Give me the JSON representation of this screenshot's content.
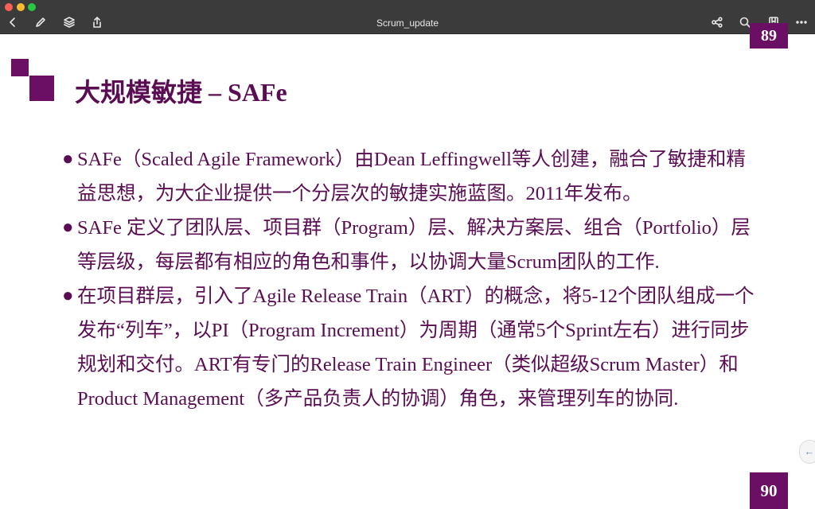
{
  "window": {
    "title": "Scrum_update",
    "traffic_colors": {
      "close": "#ff5f57",
      "minimize": "#febc2e",
      "zoom": "#28c840"
    },
    "toolbar_icons": [
      "back-icon",
      "pencil-icon",
      "layers-icon",
      "share-icon",
      "graph-icon",
      "search-icon",
      "bookmark-icon",
      "more-icon"
    ]
  },
  "slide": {
    "prev_page_number": "89",
    "page_number": "90",
    "title_cn": "大规模敏捷",
    "title_dash": "–",
    "title_en": "SAFe",
    "bullet_glyph": "●",
    "bullets": [
      "SAFe（Scaled Agile Framework）由Dean Leffingwell等人创建，融合了敏捷和精益思想，为大企业提供一个分层次的敏捷实施蓝图。2011年发布。",
      "SAFe 定义了团队层、项目群（Program）层、解决方案层、组合（Portfolio）层等层级，每层都有相应的角色和事件，以协调大量Scrum团队的工作.",
      "在项目群层，引入了Agile Release Train（ART）的概念，将5-12个团队组成一个发布“列车”，以PI（Program Increment）为周期（通常5个Sprint左右）进行同步规划和交付。ART有专门的Release Train Engineer（类似超级Scrum Master）和Product Management（多产品负责人的协调）角色，来管理列车的协同."
    ],
    "accent_color": "#6a0f63",
    "side_handle_glyph": "←"
  }
}
